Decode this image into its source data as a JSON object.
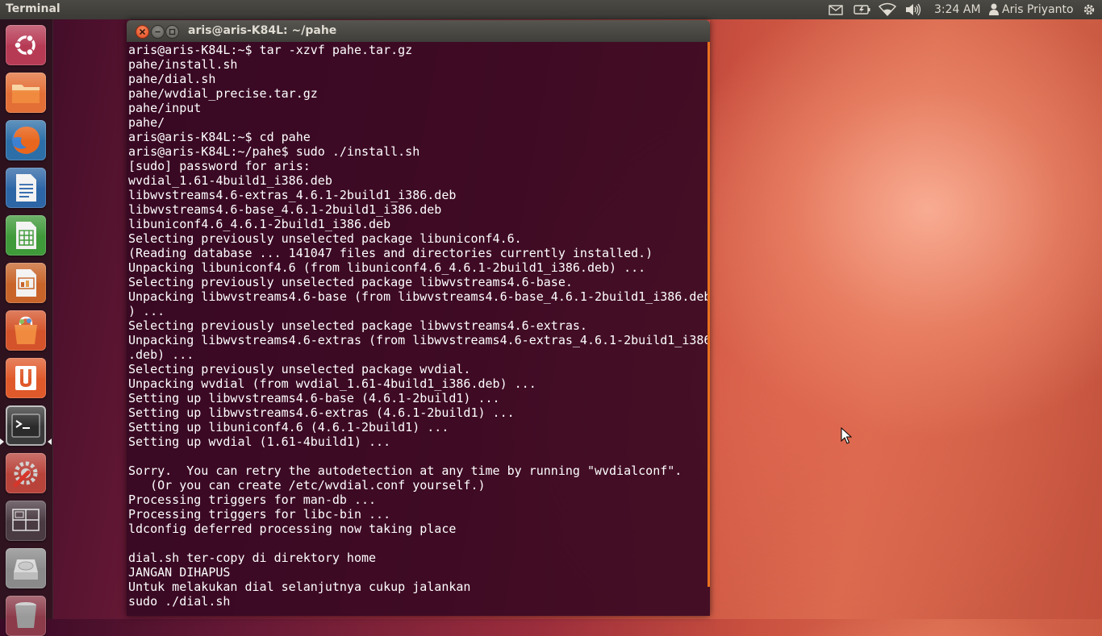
{
  "top_panel": {
    "app_title": "Terminal",
    "clock": "3:24 AM",
    "user_name": "Aris Priyanto",
    "indicators": [
      "mail-icon",
      "battery-icon",
      "wifi-icon",
      "volume-icon",
      "session-gear-icon"
    ]
  },
  "launcher": {
    "items": [
      {
        "name": "dash-home",
        "icon": "ubuntu-logo-icon"
      },
      {
        "name": "files",
        "icon": "folder-icon"
      },
      {
        "name": "firefox",
        "icon": "firefox-icon"
      },
      {
        "name": "writer",
        "icon": "libreoffice-writer-icon"
      },
      {
        "name": "calc",
        "icon": "libreoffice-calc-icon"
      },
      {
        "name": "impress",
        "icon": "libreoffice-impress-icon"
      },
      {
        "name": "software-center",
        "icon": "shopping-bag-icon"
      },
      {
        "name": "ubuntu-one",
        "icon": "ubuntu-one-icon"
      },
      {
        "name": "terminal",
        "icon": "terminal-icon",
        "running": true
      },
      {
        "name": "system-settings",
        "icon": "settings-wrench-icon"
      },
      {
        "name": "workspace-switcher",
        "icon": "workspaces-icon"
      },
      {
        "name": "drive",
        "icon": "hard-drive-icon"
      },
      {
        "name": "trash",
        "icon": "trash-icon"
      }
    ]
  },
  "terminal_window": {
    "title": "aris@aris-K84L: ~/pahe",
    "content": "aris@aris-K84L:~$ tar -xzvf pahe.tar.gz\npahe/install.sh\npahe/dial.sh\npahe/wvdial_precise.tar.gz\npahe/input\npahe/\naris@aris-K84L:~$ cd pahe\naris@aris-K84L:~/pahe$ sudo ./install.sh\n[sudo] password for aris:\nwvdial_1.61-4build1_i386.deb\nlibwvstreams4.6-extras_4.6.1-2build1_i386.deb\nlibwvstreams4.6-base_4.6.1-2build1_i386.deb\nlibuniconf4.6_4.6.1-2build1_i386.deb\nSelecting previously unselected package libuniconf4.6.\n(Reading database ... 141047 files and directories currently installed.)\nUnpacking libuniconf4.6 (from libuniconf4.6_4.6.1-2build1_i386.deb) ...\nSelecting previously unselected package libwvstreams4.6-base.\nUnpacking libwvstreams4.6-base (from libwvstreams4.6-base_4.6.1-2build1_i386.deb\n) ...\nSelecting previously unselected package libwvstreams4.6-extras.\nUnpacking libwvstreams4.6-extras (from libwvstreams4.6-extras_4.6.1-2build1_i386\n.deb) ...\nSelecting previously unselected package wvdial.\nUnpacking wvdial (from wvdial_1.61-4build1_i386.deb) ...\nSetting up libwvstreams4.6-base (4.6.1-2build1) ...\nSetting up libwvstreams4.6-extras (4.6.1-2build1) ...\nSetting up libuniconf4.6 (4.6.1-2build1) ...\nSetting up wvdial (1.61-4build1) ...\n\nSorry.  You can retry the autodetection at any time by running \"wvdialconf\".\n   (Or you can create /etc/wvdial.conf yourself.)\nProcessing triggers for man-db ...\nProcessing triggers for libc-bin ...\nldconfig deferred processing now taking place\n\ndial.sh ter-copy di direktory home\nJANGAN DIHAPUS\nUntuk melakukan dial selanjutnya cukup jalankan\nsudo ./dial.sh"
  },
  "colors": {
    "panel_bg": "#3c3b37",
    "panel_text": "#dfdbd2",
    "terminal_bg": "#360822",
    "terminal_text": "#ffffff",
    "close_button": "#f0643c",
    "scrollbar_accent": "#e8701f"
  }
}
